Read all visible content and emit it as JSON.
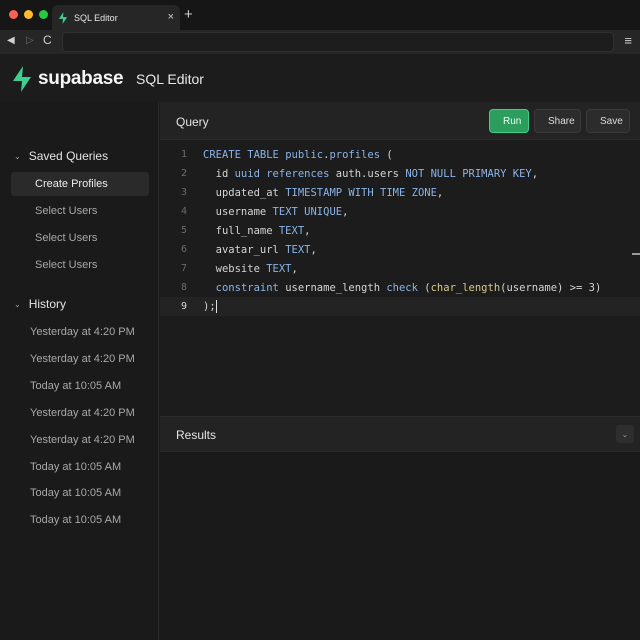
{
  "browser": {
    "tab_title": "SQL Editor",
    "tab_close": "×",
    "new_tab": "+",
    "back": "◀",
    "forward": "▷",
    "reload": "C",
    "menu": "≡",
    "url": ""
  },
  "colors": {
    "accent_green": "#3ecf8e",
    "run_button": "#2c9d5c",
    "traffic_red": "#ff5f57",
    "traffic_yellow": "#febc2e",
    "traffic_green": "#28c840"
  },
  "header": {
    "brand": "supabase",
    "title": "SQL Editor"
  },
  "sidebar": {
    "saved_title": "Saved Queries",
    "saved_items": [
      {
        "label": "Create Profiles",
        "active": true
      },
      {
        "label": "Select Users",
        "active": false
      },
      {
        "label": "Select Users",
        "active": false
      },
      {
        "label": "Select Users",
        "active": false
      }
    ],
    "history_title": "History",
    "history_items": [
      "Yesterday at 4:20 PM",
      "Yesterday at 4:20 PM",
      "Today at 10:05 AM",
      "Yesterday at 4:20 PM",
      "Yesterday at 4:20 PM",
      "Today at 10:05 AM",
      "Today at 10:05 AM",
      "Today at 10:05 AM"
    ]
  },
  "query": {
    "title": "Query",
    "run_label": "Run",
    "share_label": "Share",
    "save_label": "Save"
  },
  "editor": {
    "active_line": 9,
    "lines": [
      {
        "num": "1",
        "tokens": [
          [
            "kw",
            "CREATE TABLE "
          ],
          [
            "kw",
            "public"
          ],
          [
            "id",
            "."
          ],
          [
            "kw",
            "profiles"
          ],
          [
            "id",
            " ("
          ]
        ]
      },
      {
        "num": "2",
        "tokens": [
          [
            "id",
            "  id "
          ],
          [
            "kw",
            "uuid"
          ],
          [
            "id",
            " "
          ],
          [
            "kw",
            "references"
          ],
          [
            "id",
            " auth.users "
          ],
          [
            "kw",
            "NOT NULL PRIMARY KEY"
          ],
          [
            "id",
            ","
          ]
        ]
      },
      {
        "num": "3",
        "tokens": [
          [
            "id",
            "  updated_at "
          ],
          [
            "kw",
            "TIMESTAMP WITH TIME ZONE"
          ],
          [
            "id",
            ","
          ]
        ]
      },
      {
        "num": "4",
        "tokens": [
          [
            "id",
            "  username "
          ],
          [
            "kw",
            "TEXT UNIQUE"
          ],
          [
            "id",
            ","
          ]
        ]
      },
      {
        "num": "5",
        "tokens": [
          [
            "id",
            "  full_name "
          ],
          [
            "kw",
            "TEXT"
          ],
          [
            "id",
            ","
          ]
        ]
      },
      {
        "num": "6",
        "tokens": [
          [
            "id",
            "  avatar_url "
          ],
          [
            "kw",
            "TEXT"
          ],
          [
            "id",
            ","
          ]
        ]
      },
      {
        "num": "7",
        "tokens": [
          [
            "id",
            "  website "
          ],
          [
            "kw",
            "TEXT"
          ],
          [
            "id",
            ","
          ]
        ]
      },
      {
        "num": "8",
        "tokens": [
          [
            "id",
            "  "
          ],
          [
            "kw",
            "constraint"
          ],
          [
            "id",
            " username_length "
          ],
          [
            "kw",
            "check"
          ],
          [
            "id",
            " ("
          ],
          [
            "fn",
            "char_length"
          ],
          [
            "id",
            "(username) >= 3)"
          ]
        ]
      },
      {
        "num": "9",
        "tokens": [
          [
            "id",
            ");"
          ]
        ]
      }
    ]
  },
  "results": {
    "title": "Results",
    "toggle": "⌄"
  }
}
